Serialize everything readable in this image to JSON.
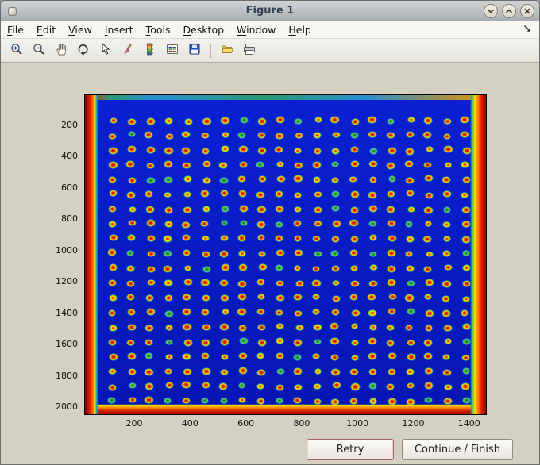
{
  "window": {
    "title": "Figure 1",
    "controls": [
      {
        "name": "minimize",
        "icon": "chevron-down"
      },
      {
        "name": "maximize",
        "icon": "chevron-up"
      },
      {
        "name": "close",
        "icon": "close-x"
      }
    ]
  },
  "menubar": {
    "items": [
      {
        "label": "File",
        "accel_index": 0
      },
      {
        "label": "Edit",
        "accel_index": 0
      },
      {
        "label": "View",
        "accel_index": 0
      },
      {
        "label": "Insert",
        "accel_index": 0
      },
      {
        "label": "Tools",
        "accel_index": 0
      },
      {
        "label": "Desktop",
        "accel_index": 0
      },
      {
        "label": "Window",
        "accel_index": 0
      },
      {
        "label": "Help",
        "accel_index": 0
      }
    ],
    "dock_icon": "dock-arrow"
  },
  "toolbar": {
    "icons": [
      "zoom-in",
      "zoom-out",
      "pan",
      "rotate-3d",
      "data-cursor",
      "brush",
      "colorbar",
      "legend",
      "save",
      "separator",
      "open",
      "print"
    ]
  },
  "plot": {
    "x_ticks": [
      200,
      400,
      600,
      800,
      1000,
      1200,
      1400
    ],
    "y_ticks": [
      200,
      400,
      600,
      800,
      1000,
      1200,
      1400,
      1600,
      1800,
      2000
    ],
    "grid": {
      "rows": 20,
      "cols": 20
    },
    "colormap": "jet",
    "description": "Microarray scan: 20x20 spot grid (red/orange centers with green rings) on blue field with saturated red-orange image borders"
  },
  "actions": {
    "retry": "Retry",
    "continue": "Continue / Finish"
  }
}
